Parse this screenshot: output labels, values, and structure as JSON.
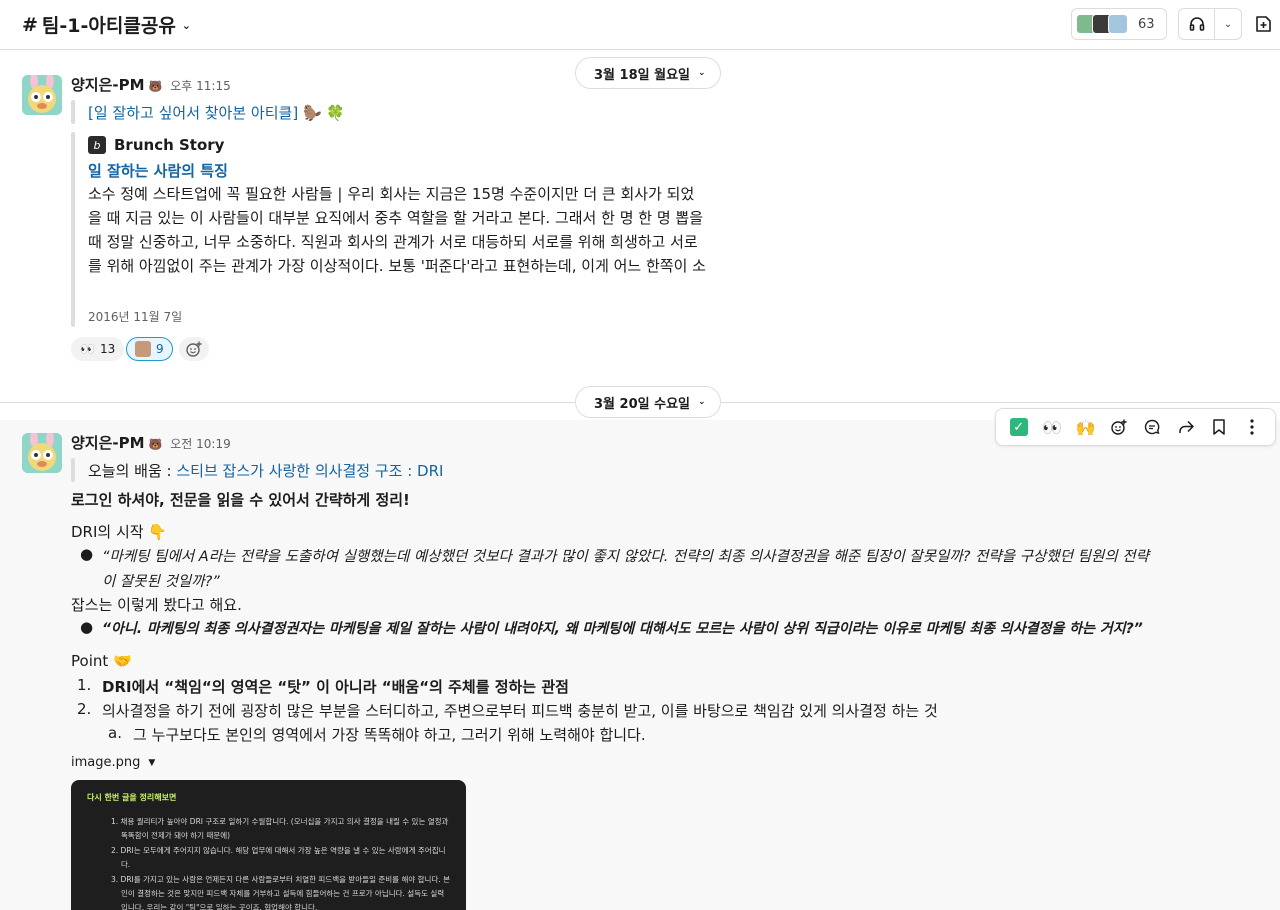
{
  "header": {
    "channel_hash": "#",
    "channel_name": "팀-1-아티클공유",
    "member_count": "63"
  },
  "date_dividers": [
    {
      "label": "3월 18일 월요일"
    },
    {
      "label": "3월 20일 수요일"
    }
  ],
  "messages": [
    {
      "sender": "양지은-PM",
      "badge": "🐻",
      "time": "오후 11:15",
      "text_link": "[일 잘하고 싶어서 찾아본 아티클]",
      "text_emoji": "🦫 🍀",
      "unfurl": {
        "site": "Brunch Story",
        "title": "일 잘하는 사람의 특징",
        "body": "소수 정예 스타트업에 꼭 필요한 사람들 | 우리 회사는 지금은 15명 수준이지만 더 큰 회사가 되었을 때 지금 있는 이 사람들이 대부분 요직에서 중추 역할을 할 거라고 본다. 그래서 한 명 한 명 뽑을 때 정말 신중하고, 너무 소중하다. 직원과 회사의 관계가 서로 대등하되 서로를 위해 희생하고 서로를 위해 아낌없이 주는 관계가 가장 이상적이다. 보통 '퍼준다'라고 표현하는데, 이게 어느 한쪽이 소",
        "date": "2016년 11월 7일"
      },
      "reactions": [
        {
          "emoji": "👀",
          "count": "13"
        },
        {
          "emoji": "avatar",
          "count": "9"
        }
      ]
    },
    {
      "sender": "양지은-PM",
      "badge": "🐻",
      "time": "오전 10:19",
      "quote_prefix": "오늘의 배움 : ",
      "quote_link": "스티브 잡스가 사랑한 의사결정 구조 : DRI",
      "summary": "로그인 하셔야, 전문을 읽을 수 있어서 간략하게 정리!",
      "section1_title": "DRI의 시작",
      "section1_emoji": "👇",
      "bullet1": "“마케팅 팀에서 A라는 전략을 도출하여 실행했는데 예상했던 것보다 결과가 많이 좋지 않았다. 전략의 최종 의사결정권을 해준 팀장이 잘못일까? 전략을 구상했던 팀원의 전략",
      "bullet1_cont": "이 잘못된 것일까?”",
      "jobs_line": "잡스는 이렇게 봤다고 해요.",
      "bullet2": "“아니. 마케팅의 최종 의사결정권자는 마케팅을 제일 잘하는 사람이 내려야지, 왜 마케팅에 대해서도 모르는 사람이 상위 직급이라는 이유로 마케팅 최종 의사결정을 하는 거지?”",
      "section2_title": "Point",
      "section2_emoji": "🤝",
      "point1_num": "1.",
      "point1": "DRI에서 “책임“의 영역은 “탓” 이 아니라 “배움“의 주체를 정하는 관점",
      "point2_num": "2.",
      "point2": "의사결정을 하기 전에 굉장히 많은 부분을 스터디하고, 주변으로부터 피드백 충분히 받고, 이를 바탕으로 책임감 있게 의사결정 하는 것",
      "point2a_num": "a.",
      "point2a": "그 누구보다도 본인의 영역에서 가장 똑똑해야 하고, 그러기 위해 노력해야 합니다.",
      "file_name": "image.png",
      "image": {
        "title": "다시 한번 글을 정리해보면",
        "items": [
          "1. 채용 퀄리티가 높아야 DRI 구조로 일하기 수월합니다. (오너십을 가지고 의사 결정을 내릴 수 있는 열정과 똑똑함이 전제가 돼야 하기 때문에)",
          "2. DRI는 모두에게 주어지지 않습니다. 해당 업무에 대해서 가장 높은 역량을 낼 수 있는 사람에게 주어집니다.",
          "3. DRI를 가지고 있는 사람은 언제든지 다른 사람들로부터 치열한 피드백을 받아들일 준비를 해야 합니다. 본인이 결정하는 것은 맞지만 피드백 자체를 거부하고 설득에 힘들어하는 건 프로가 아닙니다. 설득도 실력입니다. 우리는 같이 \"팀\"으로 일하는 곳이죠. 협업해야 합니다."
        ]
      }
    }
  ],
  "toolbar": {
    "reactions": [
      "✅",
      "👀",
      "🙌"
    ]
  }
}
